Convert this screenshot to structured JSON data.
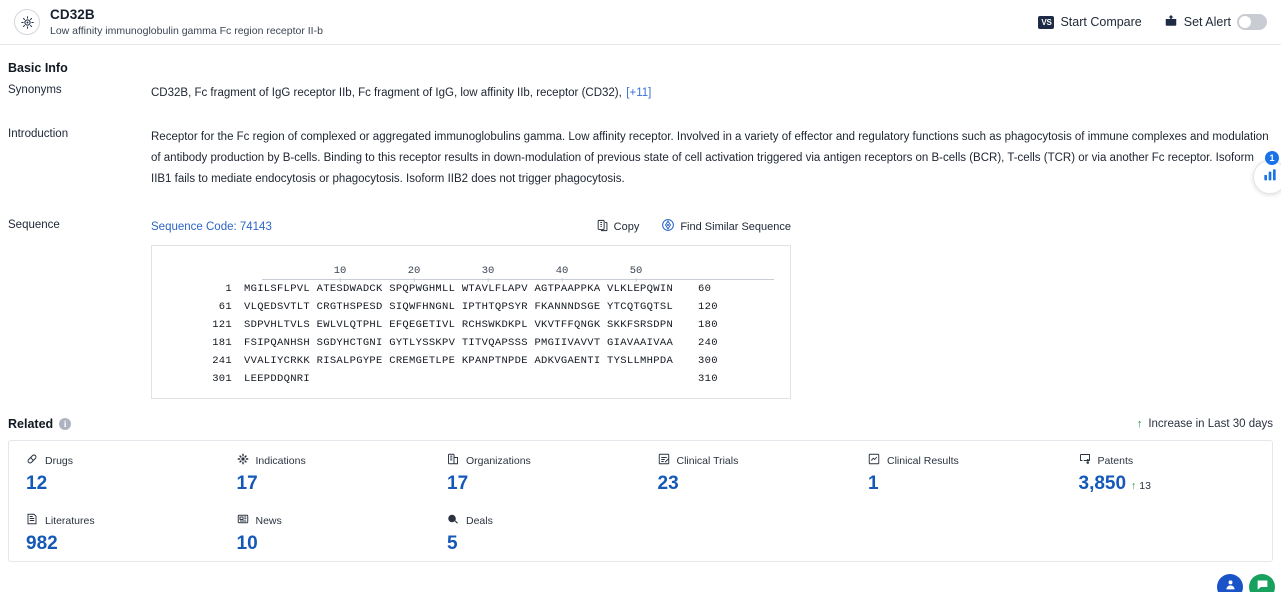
{
  "header": {
    "logo_icon": "target-crosshair-icon",
    "title": "CD32B",
    "subtitle": "Low affinity immunoglobulin gamma Fc region receptor II-b",
    "compare_badge": "VS",
    "compare_label": "Start Compare",
    "alert_icon": "bell-alert-icon",
    "alert_label": "Set Alert",
    "alert_toggle_state": "off"
  },
  "basic_info": {
    "section_title": "Basic Info",
    "synonyms_label": "Synonyms",
    "synonyms_text": "CD32B,  Fc fragment of IgG receptor IIb,  Fc fragment of IgG, low affinity IIb, receptor (CD32),",
    "synonyms_more": "[+11]",
    "introduction_label": "Introduction",
    "introduction_text": "Receptor for the Fc region of complexed or aggregated immunoglobulins gamma. Low affinity receptor. Involved in a variety of effector and regulatory functions such as phagocytosis of immune complexes and modulation of antibody production by B-cells. Binding to this receptor results in down-modulation of previous state of cell activation triggered via antigen receptors on B-cells (BCR), T-cells (TCR) or via another Fc receptor. Isoform IIB1 fails to mediate endocytosis or phagocytosis. Isoform IIB2 does not trigger phagocytosis."
  },
  "sequence": {
    "label": "Sequence",
    "code_label": "Sequence Code: 74143",
    "copy_icon": "copy-icon",
    "copy_label": "Copy",
    "find_icon": "find-similar-icon",
    "find_label": "Find Similar Sequence",
    "ruler_ticks": [
      "10",
      "20",
      "30",
      "40",
      "50"
    ],
    "lines": [
      {
        "start": "1",
        "chunks": "MGILSFLPVL ATESDWADCK SPQPWGHMLL WTAVLFLAPV AGTPAAPPKA VLKLEPQWIN",
        "end": "60"
      },
      {
        "start": "61",
        "chunks": "VLQEDSVTLT CRGTHSPESD SIQWFHNGNL IPTHTQPSYR FKANNNDSGE YTCQTGQTSL",
        "end": "120"
      },
      {
        "start": "121",
        "chunks": "SDPVHLTVLS EWLVLQTPHL EFQEGETIVL RCHSWKDKPL VKVTFFQNGK SKKFSRSDPN",
        "end": "180"
      },
      {
        "start": "181",
        "chunks": "FSIPQANHSH SGDYHCTGNI GYTLYSSKPV TITVQAPSSS PMGIIVAVVT GIAVAAIVAA",
        "end": "240"
      },
      {
        "start": "241",
        "chunks": "VVALIYCRKK RISALPGYPE CREMGETLPE KPANPTNPDE ADKVGAENTI TYSLLMHPDA",
        "end": "300"
      },
      {
        "start": "301",
        "chunks": "LEEPDDQNRI",
        "end": "310"
      }
    ]
  },
  "related": {
    "title": "Related",
    "info_icon": "info-icon",
    "legend_arrow": "↑",
    "legend_text": "Increase in Last 30 days",
    "items": [
      {
        "icon": "pill-icon",
        "label": "Drugs",
        "value": "12",
        "delta": ""
      },
      {
        "icon": "indication-icon",
        "label": "Indications",
        "value": "17",
        "delta": ""
      },
      {
        "icon": "organization-icon",
        "label": "Organizations",
        "value": "17",
        "delta": ""
      },
      {
        "icon": "clinical-trial-icon",
        "label": "Clinical Trials",
        "value": "23",
        "delta": ""
      },
      {
        "icon": "clinical-result-icon",
        "label": "Clinical Results",
        "value": "1",
        "delta": ""
      },
      {
        "icon": "patent-icon",
        "label": "Patents",
        "value": "3,850",
        "delta": "13"
      },
      {
        "icon": "literature-icon",
        "label": "Literatures",
        "value": "982",
        "delta": ""
      },
      {
        "icon": "news-icon",
        "label": "News",
        "value": "10",
        "delta": ""
      },
      {
        "icon": "deal-icon",
        "label": "Deals",
        "value": "5",
        "delta": ""
      }
    ]
  },
  "floating": {
    "side_badge_count": "1",
    "side_icon": "chart-widget-icon",
    "bottom_primary_icon": "assistant-icon",
    "bottom_secondary_icon": "chat-icon"
  },
  "colors": {
    "accent_blue": "#1458b8",
    "link_blue": "#2d64c7",
    "increase_green": "#1f8a4c",
    "header_dark": "#1d2b45"
  }
}
